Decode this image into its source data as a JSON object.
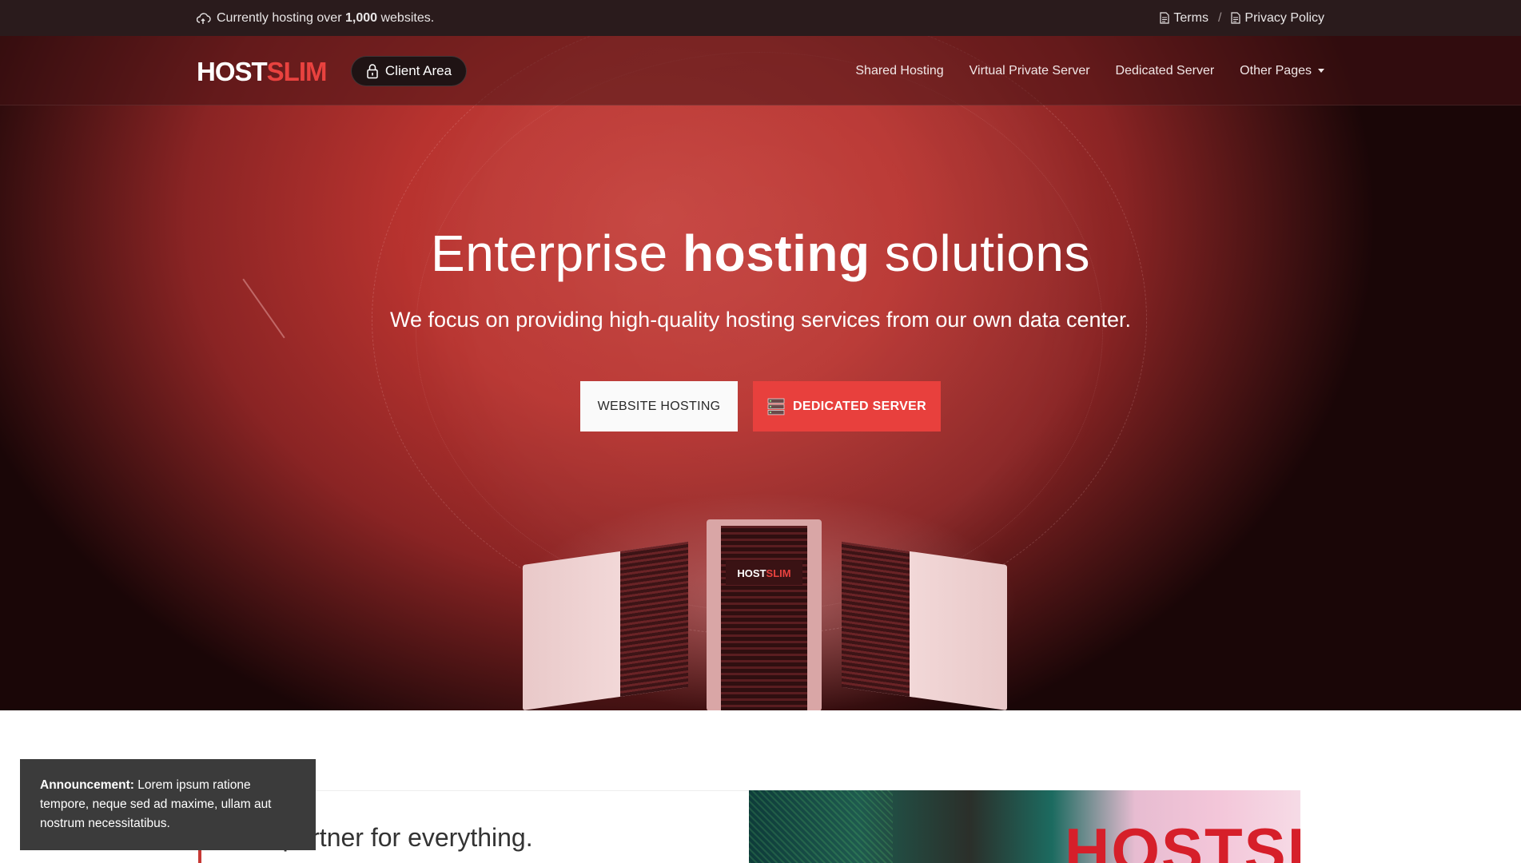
{
  "topbar": {
    "hosting_prefix": "Currently hosting over",
    "hosting_count": "1,000",
    "hosting_suffix": "websites.",
    "terms_label": "Terms",
    "separator": "/",
    "privacy_label": "Privacy Policy"
  },
  "navbar": {
    "logo_part1": "HOST",
    "logo_part2": "SLIM",
    "client_area_label": "Client Area",
    "links": [
      "Shared Hosting",
      "Virtual Private Server",
      "Dedicated Server",
      "Other Pages"
    ]
  },
  "hero": {
    "title_part1": "Enterprise",
    "title_strong": "hosting",
    "title_part3": "solutions",
    "subtitle": "We focus on providing high-quality hosting services from our own data center.",
    "btn_website": "WEBSITE HOSTING",
    "btn_dedicated": "DEDICATED SERVER",
    "server_brand_part1": "HOST",
    "server_brand_part2": "SLIM"
  },
  "section": {
    "partner_heading": "Your partner for everything.",
    "photo_sign": "HOSTSLIM"
  },
  "announcement": {
    "label": "Announcement:",
    "text": "Lorem ipsum ratione tempore, neque sed ad maxime, ullam aut nostrum necessitatibus."
  },
  "colors": {
    "accent": "#e8403d",
    "topbar_bg": "#2a1b1c",
    "hero_red": "#b8332f",
    "toast_bg": "#3b3b3b"
  },
  "icons": {
    "hosting": "cloud-icon",
    "terms": "document-icon",
    "privacy": "document-icon",
    "client_area": "lock-icon",
    "dedicated_button": "server-icon",
    "dropdown": "caret-down-icon"
  }
}
